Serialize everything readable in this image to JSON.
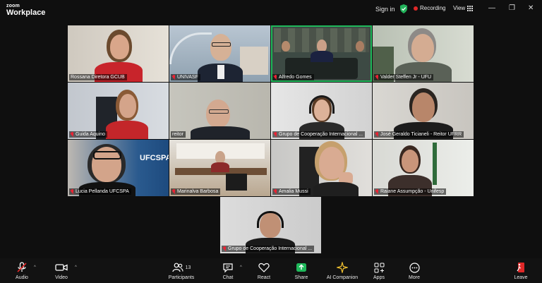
{
  "app": {
    "brand_small": "zoom",
    "brand_large": "Workplace"
  },
  "header": {
    "sign_in": "Sign in",
    "recording": "Recording",
    "view": "View"
  },
  "participants_tiles": [
    {
      "name": "Rossana Diretora GCUB",
      "muted": false
    },
    {
      "name": "UNIVASF",
      "muted": true
    },
    {
      "name": "Alfredo Gomes",
      "muted": true,
      "active": true
    },
    {
      "name": "Valder Steffen Jr - UFU",
      "muted": true
    },
    {
      "name": "Guida Aquino",
      "muted": true
    },
    {
      "name": "reitor",
      "muted": false
    },
    {
      "name": "Grupo de Cooperação Internacional ...",
      "muted": true
    },
    {
      "name": "José Geraldo Ticianeli - Reitor UFRR",
      "muted": true
    },
    {
      "name": "Lucia Pellanda UFCSPA",
      "muted": true
    },
    {
      "name": "Marinalva Barbosa",
      "muted": true
    },
    {
      "name": "Amalia Mussi",
      "muted": true
    },
    {
      "name": "Raiane Assumpção - Unifesp",
      "muted": true
    },
    {
      "name": "Grupo de Cooperação Internacional ...",
      "muted": true
    }
  ],
  "ufcspa_sign": "UFCSPA",
  "toolbar": {
    "audio": "Audio",
    "video": "Video",
    "participants": "Participants",
    "participants_count": "13",
    "chat": "Chat",
    "react": "React",
    "share": "Share",
    "ai_companion": "AI Companion",
    "apps": "Apps",
    "more": "More",
    "leave": "Leave"
  }
}
